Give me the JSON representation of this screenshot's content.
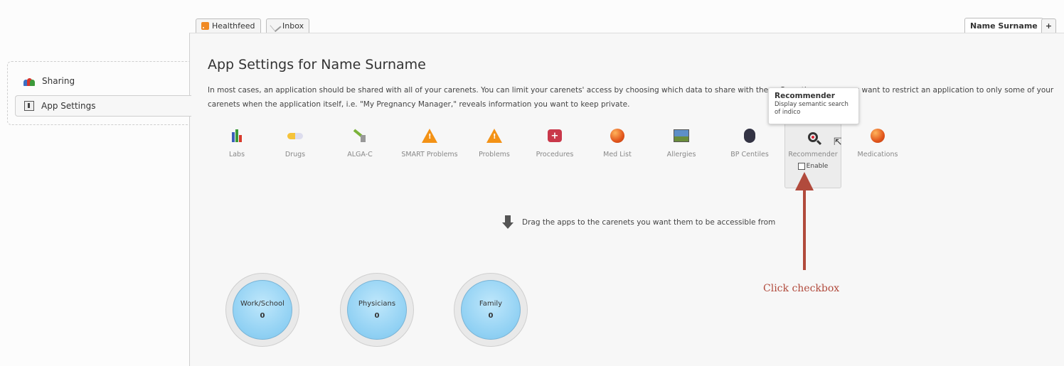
{
  "tabs": {
    "healthfeed": "Healthfeed",
    "inbox": "Inbox",
    "account": "Name Surname",
    "add": "+"
  },
  "sidebar": {
    "items": [
      {
        "label": "Sharing",
        "icon": "people-icon"
      },
      {
        "label": "App Settings",
        "icon": "settings-icon",
        "selected": true
      }
    ]
  },
  "main": {
    "title": "App Settings for Name Surname",
    "intro": "In most cases, an application should be shared with all of your carenets. You can limit your carenets' access by choosing which data to share with them. Sometimes, you may want to restrict an application to only some of your carenets when the application itself, i.e. \"My Pregnancy Manager,\" reveals information you want to keep private.",
    "apps": [
      {
        "label": "Labs",
        "icon": "bar-chart-icon"
      },
      {
        "label": "Drugs",
        "icon": "pill-icon"
      },
      {
        "label": "ALGA-C",
        "icon": "tool-icon"
      },
      {
        "label": "SMART Problems",
        "icon": "warning-icon"
      },
      {
        "label": "Problems",
        "icon": "warning-icon"
      },
      {
        "label": "Procedures",
        "icon": "medkit-icon"
      },
      {
        "label": "Med List",
        "icon": "sphere-icon"
      },
      {
        "label": "Allergies",
        "icon": "landscape-icon"
      },
      {
        "label": "BP Centiles",
        "icon": "cuff-icon"
      },
      {
        "label": "Recommender",
        "icon": "magnifier-icon",
        "enable_label": "Enable",
        "enabled": false
      },
      {
        "label": "Medications",
        "icon": "sphere-icon"
      }
    ],
    "tooltip": {
      "title": "Recommender",
      "description": "Display semantic search of indico"
    },
    "drag_hint": "Drag the apps to the carenets you want them to be accessible from",
    "carenets": [
      {
        "name": "Work/School",
        "count": "0"
      },
      {
        "name": "Physicians",
        "count": "0"
      },
      {
        "name": "Family",
        "count": "0"
      }
    ]
  },
  "annotation": {
    "label": "Click checkbox",
    "color": "#b14a3c"
  }
}
